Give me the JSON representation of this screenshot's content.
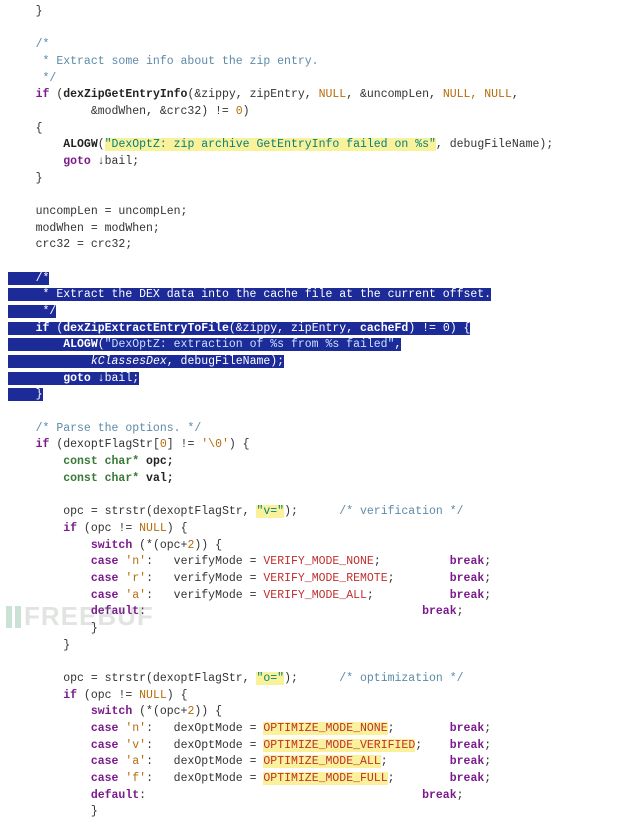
{
  "watermark": "FREEBUF",
  "code": {
    "l00": "    }",
    "c01a": "/*",
    "c01b": " * Extract some info about the zip entry.",
    "c01c": " */",
    "l02a_kw": "if",
    "l02a_fn": "dexZipGetEntryInfo",
    "l02a_args": "(&zippy, zipEntry, ",
    "l02a_null1": "NULL",
    "l02a_mid": ", &uncompLen, ",
    "l02a_nulls": "NULL, NULL",
    "l02a_end": ",",
    "l02b": "            &modWhen, &crc32) != ",
    "l02b_num": "0",
    "l02b_tail": ")",
    "l03": "{",
    "l04_fn": "ALOGW",
    "l04_open": "(",
    "l04_str": "\"DexOptZ: zip archive GetEntryInfo failed on %s\"",
    "l04_mid": ", debugFileName);",
    "l05_kw": "goto",
    "l05_rest": " ↓bail;",
    "l06": "}",
    "l07": "uncompLen = uncompLen;",
    "l08": "modWhen = modWhen;",
    "l09": "crc32 = crc32;",
    "s01": "/*",
    "s02": " * Extract the DEX data into the cache file at the current offset.",
    "s03": " */",
    "s04_kw": "if",
    "s04_open": " (",
    "s04_fn": "dexZipExtractEntryToFile",
    "s04_args": "(&zippy, zipEntry, ",
    "s04_id": "cacheFd",
    "s04_tail": ") != ",
    "s04_num": "0",
    "s04_close": ") {",
    "s05_fn": "ALOGW",
    "s05_open": "(",
    "s05_str": "\"DexOptZ: extraction of %s from %s failed\"",
    "s05_close": ",",
    "s06_a": "kClassesDex",
    "s06_b": ", debugFileName);",
    "s07_kw": "goto",
    "s07_rest": " ↓bail;",
    "s08": "}",
    "c10": "/* Parse the options. */",
    "l11_kw": "if",
    "l11_a": " (dexoptFlagStr[",
    "l11_num": "0",
    "l11_b": "] != ",
    "l11_ch": "'\\0'",
    "l11_c": ") {",
    "l12_ty": "const char*",
    "l12_id": " opc;",
    "l13_ty": "const char*",
    "l13_id": " val;",
    "l15a": "opc = strstr(dexoptFlagStr, ",
    "l15s": "\"v=\"",
    "l15b": ");",
    "l15c": "/* verification */",
    "l16_kw": "if",
    "l16a": " (opc != ",
    "l16n": "NULL",
    "l16b": ") {",
    "l17_kw": "switch",
    "l17a": " (*(opc+",
    "l17n": "2",
    "l17b": ")) {",
    "l18_kw": "case",
    "l18_ch": "'n'",
    "l18_a": ":   verifyMode = ",
    "l18_v": "VERIFY_MODE_NONE",
    "l18_b": ";",
    "l18_br": "break",
    "l19_kw": "case",
    "l19_ch": "'r'",
    "l19_a": ":   verifyMode = ",
    "l19_v": "VERIFY_MODE_REMOTE",
    "l19_b": ";",
    "l20_kw": "case",
    "l20_ch": "'a'",
    "l20_a": ":   verifyMode = ",
    "l20_v": "VERIFY_MODE_ALL",
    "l20_b": ";",
    "l21_kw": "default",
    "l21_a": ":",
    "l22": "}",
    "l23": "}",
    "l25a": "opc = strstr(dexoptFlagStr, ",
    "l25s": "\"o=\"",
    "l25b": ");",
    "l25c": "/* optimization */",
    "l26_kw": "if",
    "l26a": " (opc != ",
    "l26n": "NULL",
    "l26b": ") {",
    "l27_kw": "switch",
    "l27a": " (*(opc+",
    "l27n": "2",
    "l27b": ")) {",
    "l28_kw": "case",
    "l28_ch": "'n'",
    "l28_a": ":   dexOptMode = ",
    "l28_v": "OPTIMIZE_MODE_NONE",
    "l28_b": ";",
    "l29_kw": "case",
    "l29_ch": "'v'",
    "l29_a": ":   dexOptMode = ",
    "l29_v": "OPTIMIZE_MODE_VERIFIED",
    "l29_b": ";",
    "l30_kw": "case",
    "l30_ch": "'a'",
    "l30_a": ":   dexOptMode = ",
    "l30_v": "OPTIMIZE_MODE_ALL",
    "l30_b": ";",
    "l31_kw": "case",
    "l31_ch": "'f'",
    "l31_a": ":   dexOptMode = ",
    "l31_v": "OPTIMIZE_MODE_FULL",
    "l31_b": ";",
    "l32_kw": "default",
    "l32_a": ":",
    "l33": "}"
  }
}
